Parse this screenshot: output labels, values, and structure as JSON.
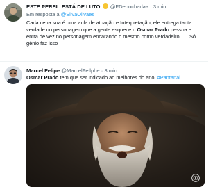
{
  "tweets": [
    {
      "author": {
        "name": "ESTE PERFIL ESTÁ DE LUTO",
        "name_emoji": "crying-face-emoji",
        "handle": "@FDebochadaa",
        "time": "3 min"
      },
      "reply": {
        "prefix": "Em resposta a",
        "mention": "@SilvaOlivaes"
      },
      "text": {
        "part1": "Cada cena sua é uma aula de atuação e Interpretação, ele entrega tanta verdade no personagem que a gente esquece o ",
        "bold": "Osmar Prado",
        "part2": " pessoa e entra de vez no personagem encarando o mesmo como verdadeiro ..... Só gênio faz isso"
      }
    },
    {
      "author": {
        "name": "Marcel Felipe",
        "handle": "@MarcelFellphe",
        "time": "3 min"
      },
      "text": {
        "bold": "Osmar Prado",
        "part1": " tem que ser indicado ao melhores do ano. ",
        "hashtag": "#Pantanal"
      },
      "media": {
        "description_icon": "tv-globo-watermark-icon"
      }
    }
  ],
  "separator": "·",
  "colors": {
    "link": "#1d9bf0",
    "secondary_text": "#536471",
    "primary_text": "#0f1419",
    "divider": "#eff3f4"
  }
}
